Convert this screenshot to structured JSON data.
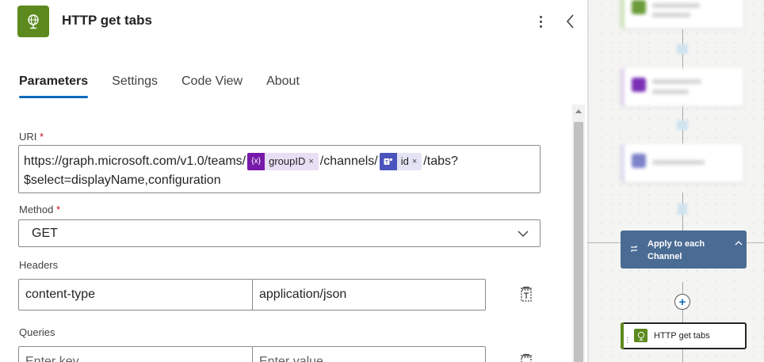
{
  "header": {
    "title": "HTTP get tabs",
    "icon": "globe-icon"
  },
  "tabs": [
    {
      "label": "Parameters",
      "active": true
    },
    {
      "label": "Settings",
      "active": false
    },
    {
      "label": "Code View",
      "active": false
    },
    {
      "label": "About",
      "active": false
    }
  ],
  "uri": {
    "label": "URI",
    "required_mark": "*",
    "part1": "https://graph.microsoft.com/v1.0/teams/",
    "token1": {
      "icon_text": "{x}",
      "label": "groupID",
      "remove": "×"
    },
    "part2": "/channels/",
    "token2": {
      "icon": "teams-icon",
      "label": "id",
      "remove": "×"
    },
    "part3": "/tabs?",
    "part4": "$select=displayName,configuration"
  },
  "method": {
    "label": "Method",
    "required_mark": "*",
    "value": "GET"
  },
  "headers": {
    "label": "Headers",
    "key": "content-type",
    "value": "application/json"
  },
  "queries": {
    "label": "Queries",
    "key_placeholder": "Enter key",
    "value_placeholder": "Enter value"
  },
  "canvas": {
    "apply_card": {
      "title": "Apply to each Channel",
      "icon": "loop-icon"
    },
    "http_card": {
      "title": "HTTP get tabs"
    }
  },
  "colors": {
    "accent": "#0f6cbd",
    "http_green": "#5c8a1e",
    "apply_blue": "#4a6b94",
    "variable_purple": "#7719aa",
    "teams_indigo": "#4b53bc"
  }
}
